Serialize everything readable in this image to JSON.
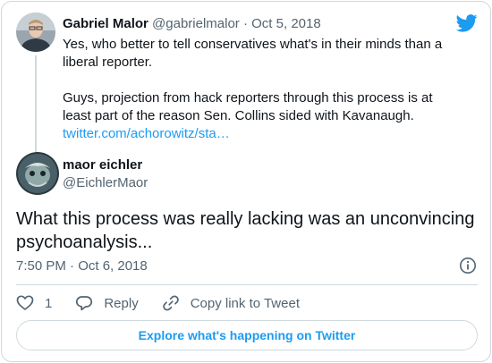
{
  "colors": {
    "link": "#1d9bf0",
    "muted": "#536471",
    "border": "#cfd9de",
    "text": "#0f1419"
  },
  "parent_tweet": {
    "author_name": "Gabriel Malor",
    "author_handle": "@gabrielmalor",
    "separator": "·",
    "date": "Oct 5, 2018",
    "text_line1": "Yes, who better to tell conservatives what's in their minds than a liberal reporter.",
    "text_line2": "Guys, projection from hack reporters through this process is at least part of the reason Sen. Collins sided with Kavanaugh.",
    "link_text": "twitter.com/achorowitz/sta…"
  },
  "reply_tweet": {
    "author_name": "maor eichler",
    "author_handle": "@EichlerMaor",
    "text": "What this process was really lacking was an unconvincing psychoanalysis...",
    "timestamp": "7:50 PM · Oct 6, 2018"
  },
  "actions": {
    "like_count": "1",
    "reply_label": "Reply",
    "copy_label": "Copy link to Tweet"
  },
  "explore_label": "Explore what's happening on Twitter",
  "icons": [
    "twitter-bird-icon",
    "info-icon",
    "heart-icon",
    "reply-bubble-icon",
    "link-icon"
  ]
}
